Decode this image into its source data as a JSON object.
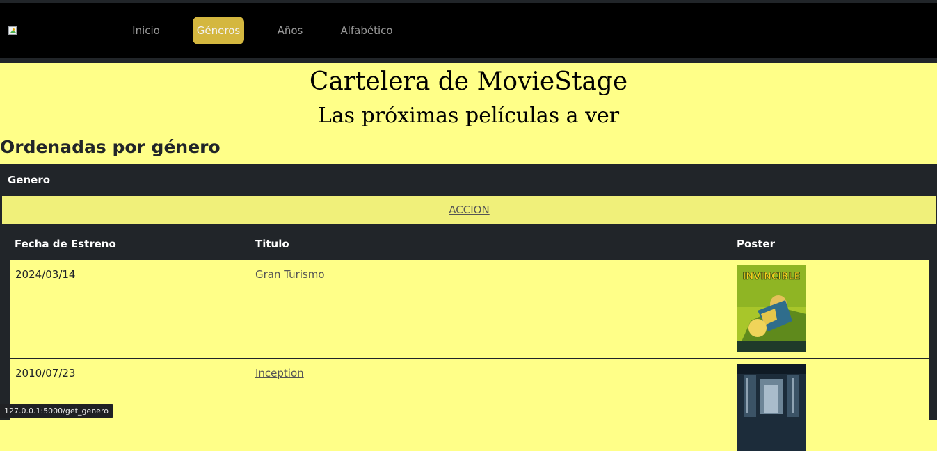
{
  "nav": {
    "logo_icon": "broken-image-icon",
    "items": [
      {
        "label": "Inicio",
        "active": false
      },
      {
        "label": "Géneros",
        "active": true
      },
      {
        "label": "Años",
        "active": false
      },
      {
        "label": "Alfabético",
        "active": false
      }
    ]
  },
  "page": {
    "title": "Cartelera de MovieStage",
    "subtitle": "Las próximas películas a ver",
    "section_heading": "Ordenadas por género"
  },
  "table": {
    "header": "Genero",
    "genre": "ACCION",
    "columns": [
      "Fecha de Estreno",
      "Titulo",
      "Poster"
    ],
    "rows": [
      {
        "date": "2024/03/14",
        "title": "Gran Turismo",
        "poster_icon": "invincible-poster-image",
        "poster_text": "INVINCIBLE"
      },
      {
        "date": "2010/07/23",
        "title": "Inception",
        "poster_icon": "inception-poster-image"
      }
    ]
  },
  "status_bar": {
    "url": "127.0.0.1:5000/get_genero"
  },
  "colors": {
    "page_bg": "#ffff88",
    "navbar_bg": "#000000",
    "active_nav": "#d4b73f",
    "table_dark": "#212529",
    "genre_row": "#f0f07a"
  }
}
